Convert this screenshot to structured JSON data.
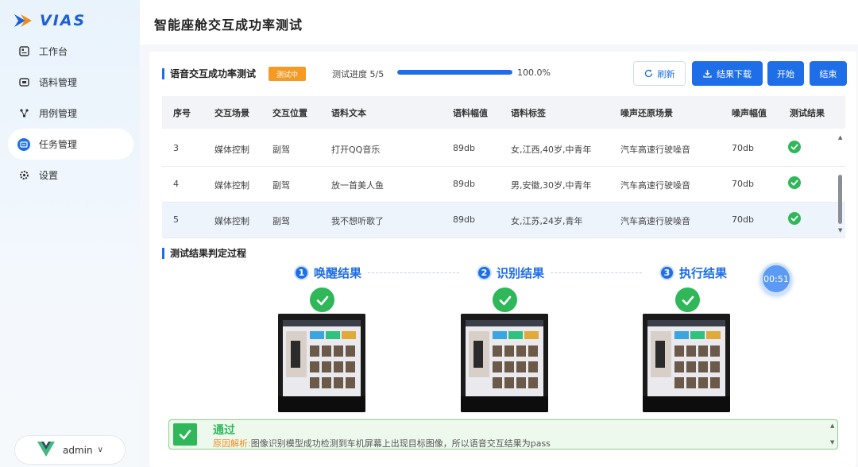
{
  "app": {
    "logo_text": "VIAS"
  },
  "page_title": "智能座舱交互成功率测试",
  "sidebar": {
    "items": [
      {
        "label": "工作台",
        "icon": "dashboard-icon",
        "active": false
      },
      {
        "label": "语料管理",
        "icon": "corpus-icon",
        "active": false
      },
      {
        "label": "用例管理",
        "icon": "case-icon",
        "active": false
      },
      {
        "label": "任务管理",
        "icon": "task-icon",
        "active": true
      },
      {
        "label": "设置",
        "icon": "gear-icon",
        "active": false
      }
    ],
    "user": {
      "name": "admin",
      "chevron": "∨"
    }
  },
  "test": {
    "section_title": "语音交互成功率测试",
    "status": "测试中",
    "progress_label": "测试进度 5/5",
    "progress_fraction": 1.0,
    "progress_pct": "100.0%"
  },
  "toolbar": {
    "refresh": "刷新",
    "download": "结果下载",
    "start": "开始",
    "end": "结束"
  },
  "table": {
    "headers": [
      "序号",
      "交互场景",
      "交互位置",
      "语料文本",
      "语料幅值",
      "语料标签",
      "噪声还原场景",
      "噪声幅值",
      "测试结果"
    ],
    "rows": [
      [
        "3",
        "媒体控制",
        "副驾",
        "打开QQ音乐",
        "89db",
        "女,江西,40岁,中青年",
        "汽车高速行驶噪音",
        "70db"
      ],
      [
        "4",
        "媒体控制",
        "副驾",
        "放一首美人鱼",
        "89db",
        "男,安徽,30岁,中青年",
        "汽车高速行驶噪音",
        "70db"
      ],
      [
        "5",
        "媒体控制",
        "副驾",
        "我不想听歌了",
        "89db",
        "女,江苏,24岁,青年",
        "汽车高速行驶噪音",
        "70db"
      ]
    ],
    "result_icon": "check-circle-icon"
  },
  "judgement": {
    "section_title": "测试结果判定过程",
    "steps": [
      {
        "num": "1",
        "label": "唤醒结果"
      },
      {
        "num": "2",
        "label": "识别结果"
      },
      {
        "num": "3",
        "label": "执行结果"
      }
    ],
    "timer": "00:51"
  },
  "result": {
    "title": "通过",
    "reason_key": "原因解析:",
    "reason_text": "图像识别模型成功检测到车机屏幕上出现目标图像，所以语音交互结果为pass"
  },
  "colors": {
    "primary": "#1e6ee8",
    "success": "#2fb75a",
    "warning": "#f59a23"
  }
}
